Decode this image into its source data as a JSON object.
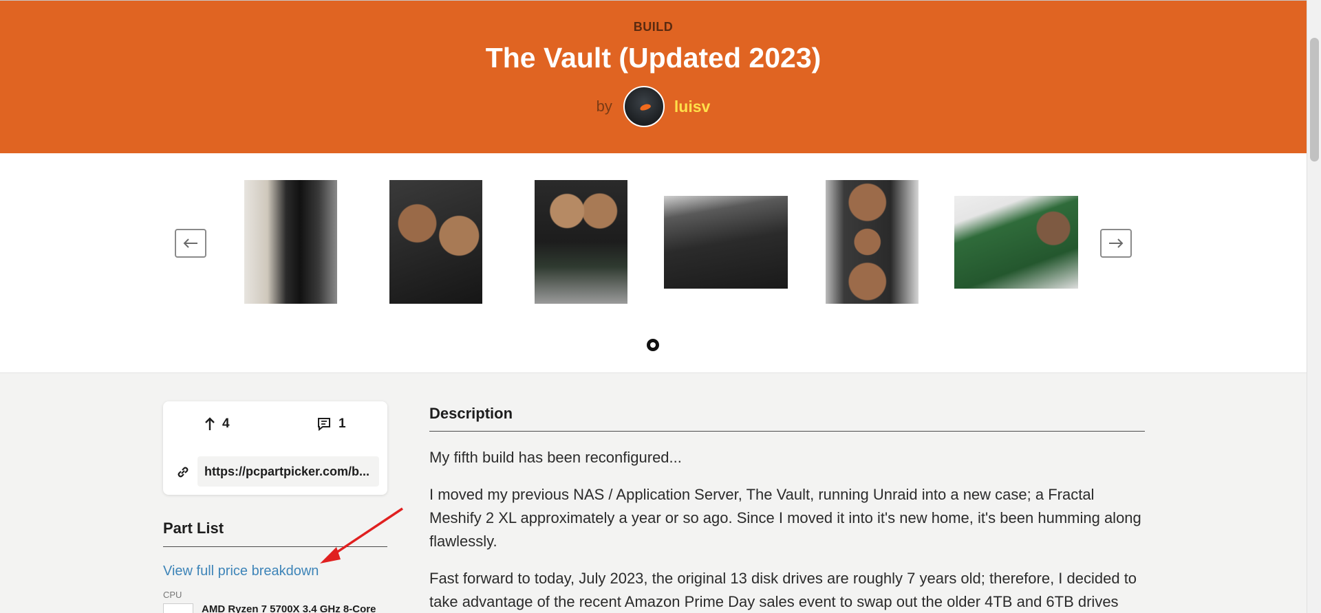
{
  "header": {
    "kicker": "BUILD",
    "title": "The Vault (Updated 2023)",
    "by_label": "by",
    "username": "luisv"
  },
  "gallery": {
    "prev_icon": "arrow-left-icon",
    "next_icon": "arrow-right-icon",
    "active_page": 1,
    "page_count": 1
  },
  "stats": {
    "votes": "4",
    "comments": "1",
    "url": "https://pcpartpicker.com/b..."
  },
  "part_list": {
    "title": "Part List",
    "price_link": "View full price breakdown",
    "items": [
      {
        "category": "CPU",
        "name": "AMD Ryzen 7 5700X 3.4 GHz 8-Core"
      }
    ]
  },
  "description": {
    "title": "Description",
    "paragraphs": [
      "My fifth build has been reconfigured...",
      "I moved my previous NAS / Application Server, The Vault, running Unraid into a new case; a Fractal Meshify 2 XL approximately a year or so ago. Since I moved it into it's new home, it's been humming along flawlessly.",
      "Fast forward to today, July 2023, the original 13 disk drives are roughly 7 years old; therefore, I decided to take advantage of the recent Amazon Prime Day sales event to swap out the older 4TB and 6TB drives"
    ]
  },
  "colors": {
    "brand": "#e06422",
    "username": "#ffe04a",
    "link": "#3d84b8",
    "annotation_arrow": "#e02020"
  }
}
